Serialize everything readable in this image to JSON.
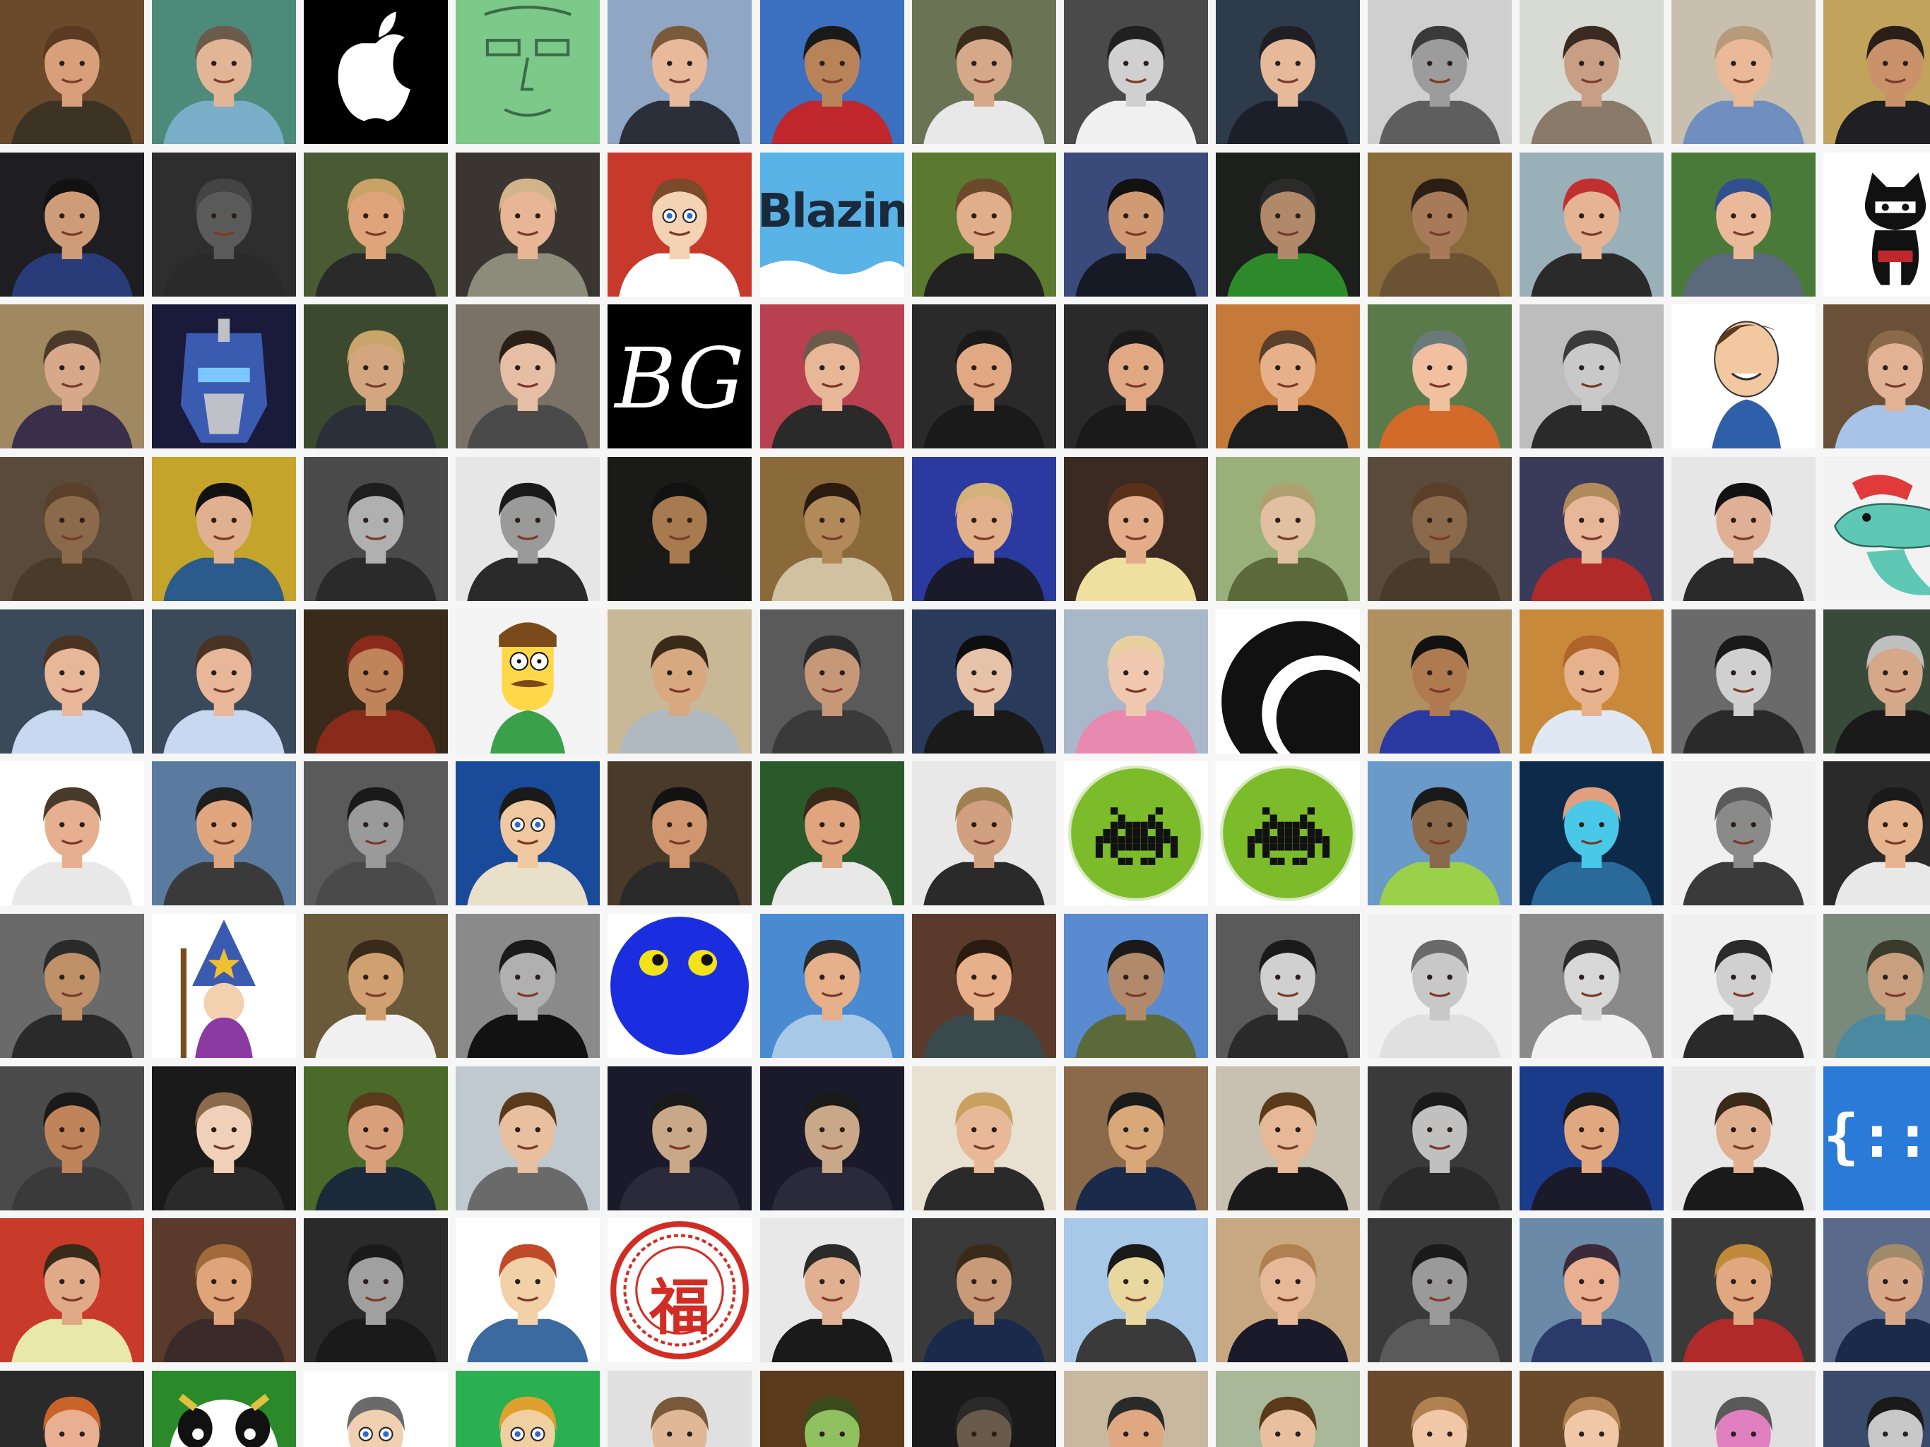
{
  "mosaic": {
    "description_hidden": "",
    "rows": 10,
    "cols": 13,
    "tiles": [
      {
        "kind": "photo",
        "bg": "#6a4a2b",
        "skin": "#d8a07a",
        "hair": "#5a3a20",
        "shirt": "#3d3324"
      },
      {
        "kind": "photo",
        "bg": "#4d8a7a",
        "skin": "#e2b596",
        "hair": "#6b5b4b",
        "shirt": "#7aaec8"
      },
      {
        "kind": "logo-apple",
        "bg": "#000000",
        "text": ""
      },
      {
        "kind": "drawing",
        "bg": "#7cc98a",
        "line": "#3b6b45"
      },
      {
        "kind": "photo",
        "bg": "#8fa6c4",
        "skin": "#e9b99b",
        "hair": "#7a5a3b",
        "shirt": "#2a2f3a"
      },
      {
        "kind": "photo",
        "bg": "#3b6fbf",
        "skin": "#b9835a",
        "hair": "#1a1a1a",
        "shirt": "#c0272d"
      },
      {
        "kind": "photo",
        "bg": "#6b7355",
        "skin": "#d6a88a",
        "hair": "#3b2b1b",
        "shirt": "#e8e8e8"
      },
      {
        "kind": "photo",
        "bg": "#4a4a4a",
        "skin": "#d0d0d0",
        "hair": "#202020",
        "shirt": "#f0f0f0"
      },
      {
        "kind": "photo",
        "bg": "#2d3b4a",
        "skin": "#e6b99a",
        "hair": "#1e1e24",
        "shirt": "#1a1f2a"
      },
      {
        "kind": "photo",
        "bg": "#cfcfcf",
        "skin": "#9c9c9c",
        "hair": "#3a3a3a",
        "shirt": "#5e5e5e"
      },
      {
        "kind": "photo",
        "bg": "#d8dad4",
        "skin": "#c89e85",
        "hair": "#3b2a22",
        "shirt": "#8a7a6a"
      },
      {
        "kind": "photo",
        "bg": "#c8bfae",
        "skin": "#e9b998",
        "hair": "#b79a7a",
        "shirt": "#6f8fc0"
      },
      {
        "kind": "photo",
        "bg": "#c2a35c",
        "skin": "#c9926b",
        "hair": "#2a1f18",
        "shirt": "#1f1f24"
      },
      {
        "kind": "photo",
        "bg": "#1d1d22",
        "skin": "#cf9c78",
        "hair": "#121212",
        "shirt": "#2a3b7a"
      },
      {
        "kind": "photo",
        "bg": "#2e2e2e",
        "skin": "#5a5a5a",
        "hair": "#444444",
        "shirt": "#2a2a2a"
      },
      {
        "kind": "photo",
        "bg": "#4a5a35",
        "skin": "#e0a47a",
        "hair": "#c9a267",
        "shirt": "#2a2a2a"
      },
      {
        "kind": "photo",
        "bg": "#3a3530",
        "skin": "#e8b597",
        "hair": "#d3b48a",
        "shirt": "#8c8c7a"
      },
      {
        "kind": "cartoon",
        "bg": "#c7392b",
        "skin": "#f3d3b3",
        "hair": "#7a4a2a",
        "shirt": "#ffffff"
      },
      {
        "kind": "logo-blazing",
        "bg": "#5ab3e6",
        "text": "Blazing"
      },
      {
        "kind": "photo",
        "bg": "#5b7a2f",
        "skin": "#e0ae8b",
        "hair": "#6a4a2a",
        "shirt": "#222222"
      },
      {
        "kind": "photo",
        "bg": "#3a4a7a",
        "skin": "#d09a73",
        "hair": "#121212",
        "shirt": "#151a24"
      },
      {
        "kind": "photo",
        "bg": "#1d1f1d",
        "skin": "#b0886a",
        "hair": "#2b2b2b",
        "shirt": "#2d8a2b"
      },
      {
        "kind": "photo",
        "bg": "#8a6b3a",
        "skin": "#a77a59",
        "hair": "#2b1e14",
        "shirt": "#6a5233"
      },
      {
        "kind": "photo",
        "bg": "#9ab0b8",
        "skin": "#e6b393",
        "hair": "#c03030",
        "shirt": "#2a2a2a"
      },
      {
        "kind": "photo",
        "bg": "#4a7a3a",
        "skin": "#eab99a",
        "hair": "#2f4f8f",
        "shirt": "#5a6a7a"
      },
      {
        "kind": "octocat",
        "bg": "#ffffff",
        "body": "#111111"
      },
      {
        "kind": "photo",
        "bg": "#a08860",
        "skin": "#d7a98a",
        "hair": "#4b3a2b",
        "shirt": "#3a2f4a"
      },
      {
        "kind": "robot",
        "bg": "#1a1a3a",
        "main": "#3b5bb0",
        "accent": "#c0c0c8"
      },
      {
        "kind": "photo",
        "bg": "#3b4a2f",
        "skin": "#d4a680",
        "hair": "#c8a56a",
        "shirt": "#2a2f3a"
      },
      {
        "kind": "photo",
        "bg": "#7a7266",
        "skin": "#e6bea3",
        "hair": "#2b2018",
        "shirt": "#4a4a4a"
      },
      {
        "kind": "logo-bg",
        "bg": "#000000",
        "text": "BG"
      },
      {
        "kind": "photo",
        "bg": "#b8404f",
        "skin": "#e8b797",
        "hair": "#6b5b4b",
        "shirt": "#2a2a2a"
      },
      {
        "kind": "photo",
        "bg": "#2a2a2a",
        "skin": "#e0a983",
        "hair": "#1a1a1a",
        "shirt": "#1a1a1a"
      },
      {
        "kind": "photo",
        "bg": "#2a2a2a",
        "skin": "#e0a983",
        "hair": "#1a1a1a",
        "shirt": "#1a1a1a"
      },
      {
        "kind": "photo",
        "bg": "#c57a3a",
        "skin": "#e6b08a",
        "hair": "#5a3f2a",
        "shirt": "#1e1e1e"
      },
      {
        "kind": "photo",
        "bg": "#5a7a4a",
        "skin": "#f0c0a0",
        "hair": "#6a7a7a",
        "shirt": "#d46a2a"
      },
      {
        "kind": "photo",
        "bg": "#bdbdbd",
        "skin": "#c9c9c9",
        "hair": "#3a3a3a",
        "shirt": "#2a2a2a"
      },
      {
        "kind": "caricature",
        "bg": "#ffffff",
        "skin": "#f1c8a0",
        "hair": "#5a3a1a",
        "shirt": "#2f5fa8"
      },
      {
        "kind": "photo",
        "bg": "#6a5038",
        "skin": "#e2b295",
        "hair": "#8a6a4a",
        "shirt": "#a8c3e8"
      },
      {
        "kind": "photo",
        "bg": "#5a4a3a",
        "skin": "#8a6a4a",
        "hair": "#5a3f2a",
        "shirt": "#4a3a2a"
      },
      {
        "kind": "photo",
        "bg": "#c4a42a",
        "skin": "#e0b090",
        "hair": "#121212",
        "shirt": "#2a5b8a"
      },
      {
        "kind": "photo",
        "bg": "#4a4a4a",
        "skin": "#b0b0b0",
        "hair": "#1e1e1e",
        "shirt": "#2a2a2a"
      },
      {
        "kind": "photo",
        "bg": "#e6e6e6",
        "skin": "#9a9a9a",
        "hair": "#1a1a1a",
        "shirt": "#2a2a2a"
      },
      {
        "kind": "photo",
        "bg": "#1a1a18",
        "skin": "#a87a50",
        "hair": "#121212",
        "shirt": "#1a1a1a"
      },
      {
        "kind": "photo",
        "bg": "#8a6a3a",
        "skin": "#b28a5a",
        "hair": "#2a1a10",
        "shirt": "#d0c2a0"
      },
      {
        "kind": "photo",
        "bg": "#2a3aa0",
        "skin": "#e2b08a",
        "hair": "#d0b27a",
        "shirt": "#1a1a2a"
      },
      {
        "kind": "photo",
        "bg": "#3a2a22",
        "skin": "#e4ad8a",
        "hair": "#5a3018",
        "shirt": "#f0e0a0"
      },
      {
        "kind": "photo",
        "bg": "#9ab07a",
        "skin": "#e0c0a0",
        "hair": "#b0a070",
        "shirt": "#5a6a3a"
      },
      {
        "kind": "photo",
        "bg": "#5a4a3a",
        "skin": "#8a6a4a",
        "hair": "#5a3f2a",
        "shirt": "#4a3a2a"
      },
      {
        "kind": "photo",
        "bg": "#3a3a5a",
        "skin": "#e8b699",
        "hair": "#b08a5a",
        "shirt": "#b02a2a"
      },
      {
        "kind": "photo",
        "bg": "#e6e6e6",
        "skin": "#e0b096",
        "hair": "#121212",
        "shirt": "#2a2a2a"
      },
      {
        "kind": "gator",
        "bg": "#f2f2f2",
        "main": "#5ec8b5",
        "accent": "#e03a3a"
      },
      {
        "kind": "photo",
        "bg": "#3a4a5a",
        "skin": "#e8b699",
        "hair": "#4a3322",
        "shirt": "#c8d8f0"
      },
      {
        "kind": "photo",
        "bg": "#3a4a5a",
        "skin": "#e8b699",
        "hair": "#4a3322",
        "shirt": "#c8d8f0"
      },
      {
        "kind": "photo",
        "bg": "#3a2a1a",
        "skin": "#c0845a",
        "hair": "#8a2a1a",
        "shirt": "#8a2a1a"
      },
      {
        "kind": "flanders",
        "bg": "#f3f3f3",
        "skin": "#ffd84a",
        "hair": "#7a4a1a",
        "shirt": "#3aa04a"
      },
      {
        "kind": "photo",
        "bg": "#c8b896",
        "skin": "#d8a880",
        "hair": "#3a2a1a",
        "shirt": "#b0b8c0"
      },
      {
        "kind": "photo",
        "bg": "#5a5a5a",
        "skin": "#c69878",
        "hair": "#2a2a2a",
        "shirt": "#3a3a3a"
      },
      {
        "kind": "photo",
        "bg": "#2a3a5a",
        "skin": "#e6c2a8",
        "hair": "#0e0e0e",
        "shirt": "#1a1a1a"
      },
      {
        "kind": "photo",
        "bg": "#a8b8c8",
        "skin": "#f0c8b0",
        "hair": "#e8d0a0",
        "shirt": "#e88ab0"
      },
      {
        "kind": "circle-logo",
        "bg": "#ffffff",
        "main": "#111111"
      },
      {
        "kind": "photo",
        "bg": "#b09060",
        "skin": "#b07a50",
        "hair": "#121212",
        "shirt": "#2a3aa0"
      },
      {
        "kind": "photo",
        "bg": "#c88a3a",
        "skin": "#e6b28e",
        "hair": "#b0642a",
        "shirt": "#e0e8f4"
      },
      {
        "kind": "photo",
        "bg": "#6a6a6a",
        "skin": "#d0d0d0",
        "hair": "#1a1a1a",
        "shirt": "#2a2a2a"
      },
      {
        "kind": "photo",
        "bg": "#3a4a3a",
        "skin": "#d4a888",
        "hair": "#c0c0c0",
        "shirt": "#1a1a1a"
      },
      {
        "kind": "photo",
        "bg": "#ffffff",
        "skin": "#e6b090",
        "hair": "#4a3a2a",
        "shirt": "#e8e8e8"
      },
      {
        "kind": "photo",
        "bg": "#5a7aa0",
        "skin": "#e0a67e",
        "hair": "#1e1e1e",
        "shirt": "#3a3a3a"
      },
      {
        "kind": "photo",
        "bg": "#5a5a5a",
        "skin": "#9a9a9a",
        "hair": "#1a1a1a",
        "shirt": "#4a4a4a"
      },
      {
        "kind": "cartoon",
        "bg": "#1a4a9a",
        "skin": "#f0c8a0",
        "hair": "#1a1a1a",
        "shirt": "#e8e0c8"
      },
      {
        "kind": "photo",
        "bg": "#4a3a2a",
        "skin": "#d09670",
        "hair": "#121212",
        "shirt": "#2a2a2a"
      },
      {
        "kind": "photo",
        "bg": "#2a5a2a",
        "skin": "#e0a47e",
        "hair": "#3a2a1a",
        "shirt": "#e8e8e8"
      },
      {
        "kind": "photo",
        "bg": "#e8e8e8",
        "skin": "#d0a080",
        "hair": "#a08050",
        "shirt": "#2a2a2a"
      },
      {
        "kind": "invader",
        "bg": "#ffffff",
        "main": "#7cbb2a",
        "accent": "#111111"
      },
      {
        "kind": "invader",
        "bg": "#ffffff",
        "main": "#7cbb2a",
        "accent": "#111111"
      },
      {
        "kind": "photo",
        "bg": "#6a9ac8",
        "skin": "#8a6a4a",
        "hair": "#1a1a1a",
        "shirt": "#9ad04a"
      },
      {
        "kind": "photo",
        "bg": "#0e2a4a",
        "skin": "#4ac8e8",
        "hair": "#e0a080",
        "shirt": "#2a6a9a"
      },
      {
        "kind": "photo",
        "bg": "#f0f0f0",
        "skin": "#8a8a8a",
        "hair": "#5a5a5a",
        "shirt": "#3a3a3a"
      },
      {
        "kind": "photo",
        "bg": "#2a2a2a",
        "skin": "#e6b48e",
        "hair": "#1a1a1a",
        "shirt": "#e8e8e8"
      },
      {
        "kind": "photo",
        "bg": "#6a6a6a",
        "skin": "#c09068",
        "hair": "#2a2a2a",
        "shirt": "#2a2a2a"
      },
      {
        "kind": "wizard",
        "bg": "#ffffff",
        "main": "#3a5ab0",
        "accent": "#f0c030"
      },
      {
        "kind": "photo",
        "bg": "#6a5a3a",
        "skin": "#d0a070",
        "hair": "#3a2a1a",
        "shirt": "#f0f0f0"
      },
      {
        "kind": "photo",
        "bg": "#8a8a8a",
        "skin": "#b0b0b0",
        "hair": "#1a1a1a",
        "shirt": "#121212"
      },
      {
        "kind": "blueball",
        "bg": "#ffffff",
        "main": "#1a2ee0",
        "accent": "#f2e21a"
      },
      {
        "kind": "photo",
        "bg": "#4a8ad0",
        "skin": "#e6b08a",
        "hair": "#2a2a2a",
        "shirt": "#a8c8e8"
      },
      {
        "kind": "photo",
        "bg": "#5a3a2a",
        "skin": "#e6b08a",
        "hair": "#2a1a10",
        "shirt": "#3a4a4a"
      },
      {
        "kind": "photo",
        "bg": "#5a8ad0",
        "skin": "#b08a6a",
        "hair": "#1a1a1a",
        "shirt": "#5a6a3a"
      },
      {
        "kind": "photo",
        "bg": "#5a5a5a",
        "skin": "#d0d0d0",
        "hair": "#1a1a1a",
        "shirt": "#2a2a2a"
      },
      {
        "kind": "photo",
        "bg": "#f0f0f0",
        "skin": "#c8c8c8",
        "hair": "#6a6a6a",
        "shirt": "#e0e0e0"
      },
      {
        "kind": "photo",
        "bg": "#8a8a8a",
        "skin": "#d8d8d8",
        "hair": "#2a2a2a",
        "shirt": "#f0f0f0"
      },
      {
        "kind": "photo",
        "bg": "#f0f0f0",
        "skin": "#d0d0d0",
        "hair": "#2a2a2a",
        "shirt": "#2a2a2a"
      },
      {
        "kind": "photo",
        "bg": "#7a8a7a",
        "skin": "#c8a080",
        "hair": "#3a3a2a",
        "shirt": "#4a8aa0"
      },
      {
        "kind": "photo",
        "bg": "#4a4a4a",
        "skin": "#c0845a",
        "hair": "#1a1a1a",
        "shirt": "#3a3a3a"
      },
      {
        "kind": "photo",
        "bg": "#1a1a1a",
        "skin": "#f0d0b8",
        "hair": "#8a6a4a",
        "shirt": "#2a2a2a"
      },
      {
        "kind": "photo",
        "bg": "#4a6a2a",
        "skin": "#d8a07a",
        "hair": "#5a3a1a",
        "shirt": "#1a2a3a"
      },
      {
        "kind": "photo",
        "bg": "#c0c8d0",
        "skin": "#e8c0a0",
        "hair": "#5a3a1a",
        "shirt": "#6a6a6a"
      },
      {
        "kind": "photo",
        "bg": "#1a1a2a",
        "skin": "#c8a888",
        "hair": "#1a1a1a",
        "shirt": "#2a2a3a"
      },
      {
        "kind": "photo",
        "bg": "#1a1a2a",
        "skin": "#c8a888",
        "hair": "#1a1a1a",
        "shirt": "#2a2a3a"
      },
      {
        "kind": "photo",
        "bg": "#e8e0d0",
        "skin": "#e8b898",
        "hair": "#c8a060",
        "shirt": "#2a2a2a"
      },
      {
        "kind": "photo",
        "bg": "#8a6a4a",
        "skin": "#d8a878",
        "hair": "#1a1a1a",
        "shirt": "#1a2a4a"
      },
      {
        "kind": "photo",
        "bg": "#c8c0b0",
        "skin": "#e6b898",
        "hair": "#5a3a1a",
        "shirt": "#1a1a1a"
      },
      {
        "kind": "photo",
        "bg": "#3a3a3a",
        "skin": "#c0c0c0",
        "hair": "#1a1a1a",
        "shirt": "#2a2a2a"
      },
      {
        "kind": "photo",
        "bg": "#1a3a8a",
        "skin": "#e0a880",
        "hair": "#1a1a1a",
        "shirt": "#1a1a2a"
      },
      {
        "kind": "photo",
        "bg": "#e8e8e8",
        "skin": "#e0b090",
        "hair": "#3a2a1a",
        "shirt": "#1a1a1a"
      },
      {
        "kind": "logo-braces",
        "bg": "#2a7ad8",
        "text": "{:::}"
      },
      {
        "kind": "photo",
        "bg": "#c83a2a",
        "skin": "#e0aa88",
        "hair": "#3a2a1a",
        "shirt": "#e8e8a8"
      },
      {
        "kind": "photo",
        "bg": "#5a3a2a",
        "skin": "#e0a47a",
        "hair": "#a06a3a",
        "shirt": "#3a2a2a"
      },
      {
        "kind": "photo",
        "bg": "#2a2a2a",
        "skin": "#a0a0a0",
        "hair": "#1a1a1a",
        "shirt": "#1a1a1a"
      },
      {
        "kind": "photo",
        "bg": "#ffffff",
        "skin": "#f2d0a8",
        "hair": "#c04a2a",
        "shirt": "#3a6aa0"
      },
      {
        "kind": "seal-fu",
        "bg": "#ffffff",
        "text": "福"
      },
      {
        "kind": "photo",
        "bg": "#e8e8e8",
        "skin": "#e0b090",
        "hair": "#2a2a2a",
        "shirt": "#1a1a1a"
      },
      {
        "kind": "photo",
        "bg": "#3a3a3a",
        "skin": "#c89a78",
        "hair": "#3a2a1a",
        "shirt": "#1a2a4a"
      },
      {
        "kind": "photo",
        "bg": "#a8c8e8",
        "skin": "#e8d8a0",
        "hair": "#1a1a1a",
        "shirt": "#3a3a3a"
      },
      {
        "kind": "photo",
        "bg": "#c8a880",
        "skin": "#e6b898",
        "hair": "#b08050",
        "shirt": "#1a1a2a"
      },
      {
        "kind": "photo",
        "bg": "#3a3a3a",
        "skin": "#9a9a9a",
        "hair": "#1a1a1a",
        "shirt": "#5a5a5a"
      },
      {
        "kind": "photo",
        "bg": "#6a8aa8",
        "skin": "#e8b090",
        "hair": "#3a2a3a",
        "shirt": "#2a3a6a"
      },
      {
        "kind": "photo",
        "bg": "#3a3a3a",
        "skin": "#e0a880",
        "hair": "#c08a3a",
        "shirt": "#b02a2a"
      },
      {
        "kind": "photo",
        "bg": "#5a6a8a",
        "skin": "#d8a888",
        "hair": "#a08a6a",
        "shirt": "#1a2a4a"
      },
      {
        "kind": "photo",
        "bg": "#2a2a2a",
        "skin": "#e8b090",
        "hair": "#c8642a",
        "shirt": "#2a2a2a"
      },
      {
        "kind": "cow",
        "bg": "#2a8a2a",
        "main": "#ffffff",
        "accent": "#111111"
      },
      {
        "kind": "cartoon",
        "bg": "#ffffff",
        "skin": "#f0d0b0",
        "hair": "#6a6a6a",
        "shirt": "#ffffff"
      },
      {
        "kind": "cartoon",
        "bg": "#2ab050",
        "skin": "#f0d0a0",
        "hair": "#e0a030",
        "shirt": "#ffffff"
      },
      {
        "kind": "photo",
        "bg": "#e0e0e0",
        "skin": "#e0b898",
        "hair": "#7a5a3a",
        "shirt": "#8a8a8a"
      },
      {
        "kind": "photo",
        "bg": "#5a3a1a",
        "skin": "#90c060",
        "hair": "#3a4a1a",
        "shirt": "#3a2a1a"
      },
      {
        "kind": "photo",
        "bg": "#1a1a1a",
        "skin": "#6a5a4a",
        "hair": "#2a2a2a",
        "shirt": "#1a1a1a"
      },
      {
        "kind": "photo",
        "bg": "#c8b8a0",
        "skin": "#e0a880",
        "hair": "#2a2a2a",
        "shirt": "#e8e8e8"
      },
      {
        "kind": "photo",
        "bg": "#a8b898",
        "skin": "#e8c0a0",
        "hair": "#5a3a1a",
        "shirt": "#1a1a1a"
      },
      {
        "kind": "photo",
        "bg": "#6a4a2a",
        "skin": "#f0c8a8",
        "hair": "#b08050",
        "shirt": "#2a2a2a"
      },
      {
        "kind": "photo",
        "bg": "#6a4a2a",
        "skin": "#f0c8a8",
        "hair": "#b08050",
        "shirt": "#2a2a2a"
      },
      {
        "kind": "photo",
        "bg": "#e0e0e0",
        "skin": "#e080c0",
        "hair": "#5a5a5a",
        "shirt": "#3a3a3a"
      },
      {
        "kind": "photo",
        "bg": "#3a4a6a",
        "skin": "#c8c8c8",
        "hair": "#1a1a1a",
        "shirt": "#2a2a2a"
      }
    ]
  }
}
